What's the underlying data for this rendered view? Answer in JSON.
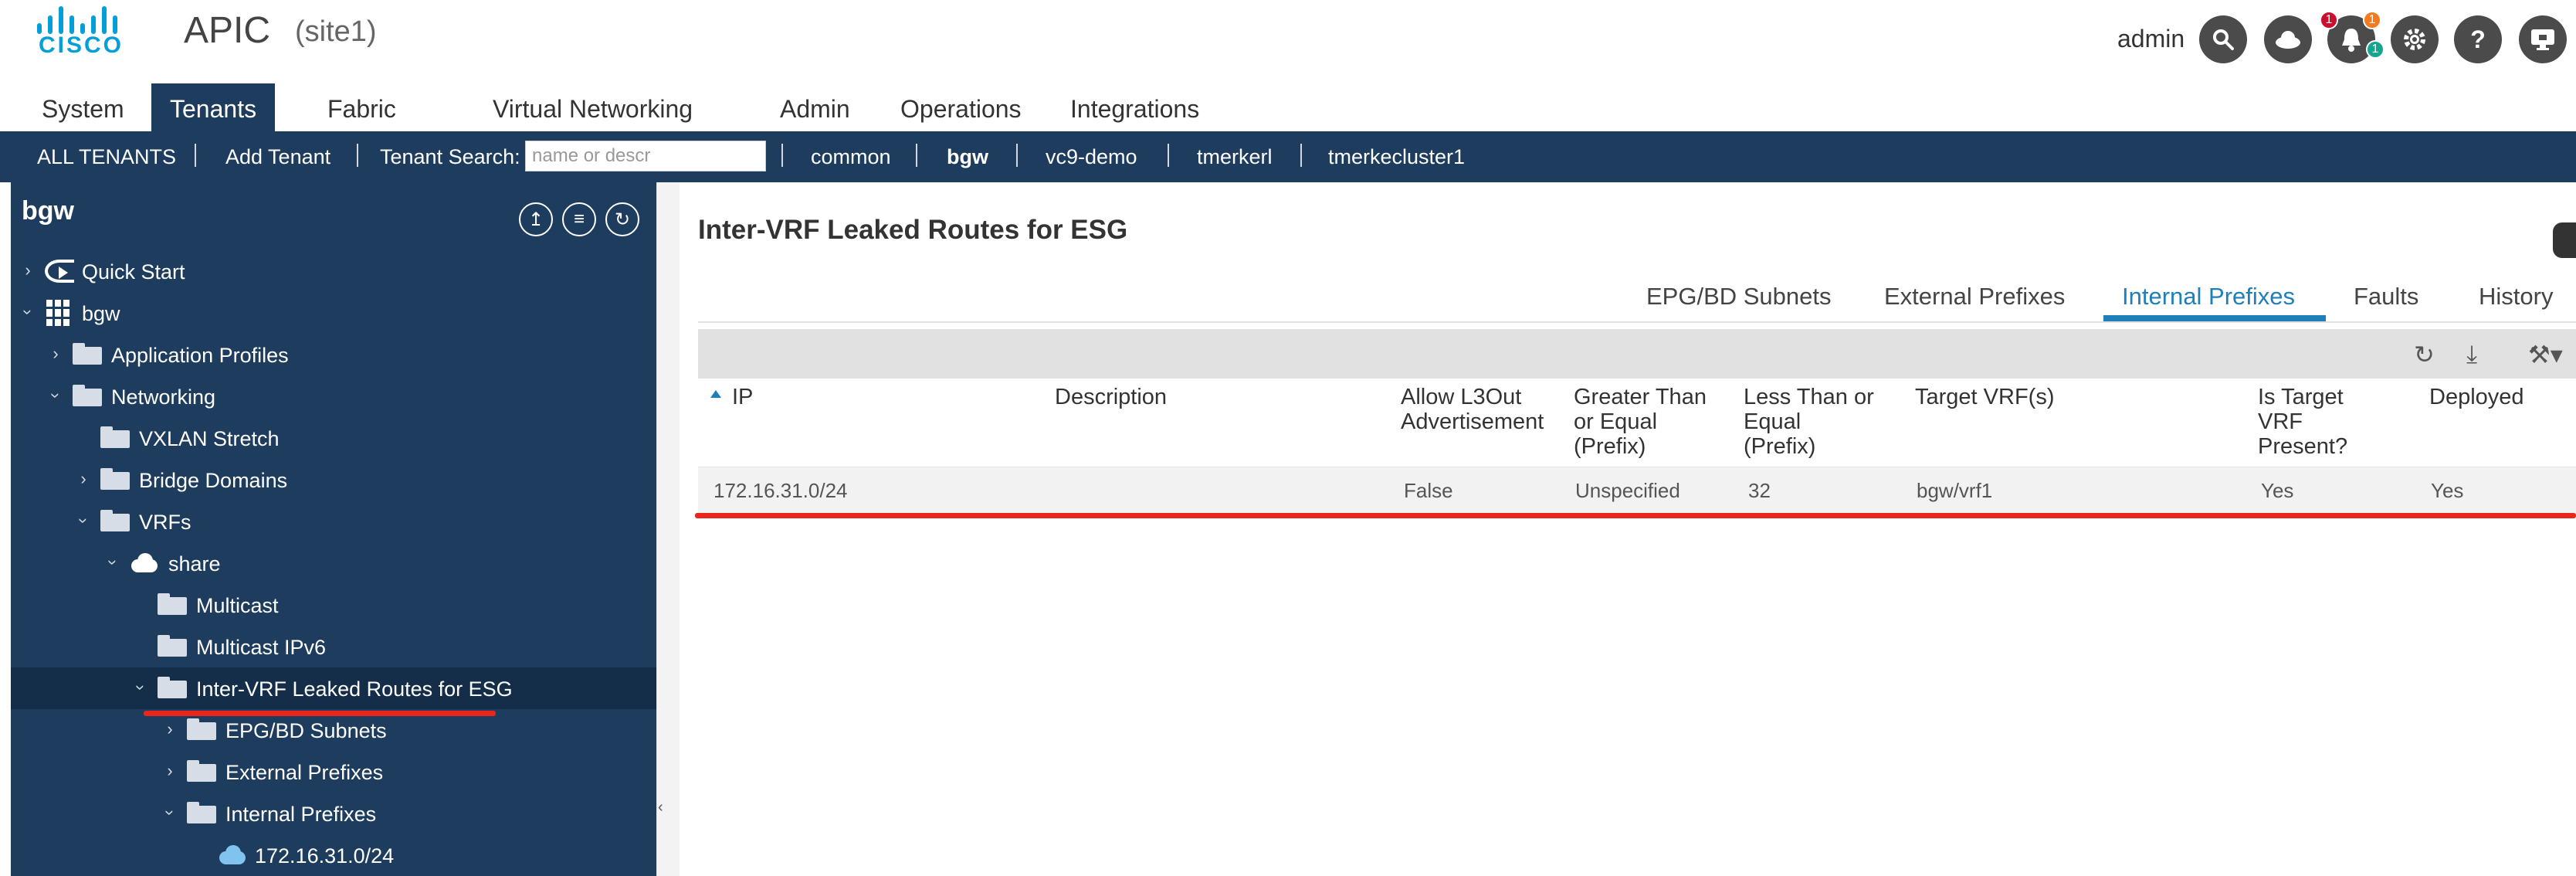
{
  "header": {
    "brand_word": "CISCO",
    "app_title": "APIC",
    "site": "(site1)",
    "user": "admin",
    "icons": [
      "search-icon",
      "cloud-icon",
      "bell-icon",
      "gear-icon",
      "help-icon",
      "monitor-icon"
    ],
    "badges": {
      "critical": "1",
      "major": "1",
      "minor": "1"
    },
    "colors": {
      "brand": "#049fd9",
      "nav": "#1d3c5e",
      "accent": "#1f7fb8",
      "highlight": "#e8261c"
    }
  },
  "main_nav": [
    "System",
    "Tenants",
    "Fabric",
    "Virtual Networking",
    "Admin",
    "Operations",
    "Integrations"
  ],
  "tenant_bar": {
    "all": "ALL TENANTS",
    "add": "Add Tenant",
    "search_label": "Tenant Search:",
    "search_placeholder": "name or descr",
    "tenants": [
      "common",
      "bgw",
      "vc9-demo",
      "tmerkerl",
      "tmerkecluster1"
    ]
  },
  "tree": {
    "title": "bgw",
    "items": [
      {
        "label": "Quick Start"
      },
      {
        "label": "bgw"
      },
      {
        "label": "Application Profiles"
      },
      {
        "label": "Networking"
      },
      {
        "label": "VXLAN Stretch"
      },
      {
        "label": "Bridge Domains"
      },
      {
        "label": "VRFs"
      },
      {
        "label": "share"
      },
      {
        "label": "Multicast"
      },
      {
        "label": "Multicast IPv6"
      },
      {
        "label": "Inter-VRF Leaked Routes for ESG"
      },
      {
        "label": "EPG/BD Subnets"
      },
      {
        "label": "External Prefixes"
      },
      {
        "label": "Internal Prefixes"
      },
      {
        "label": "172.16.31.0/24"
      }
    ]
  },
  "content": {
    "title": "Inter-VRF Leaked Routes for ESG",
    "tabs": [
      "EPG/BD Subnets",
      "External Prefixes",
      "Internal Prefixes",
      "Faults",
      "History"
    ],
    "active_tab": "Internal Prefixes",
    "columns": [
      "IP",
      "Description",
      "Allow L3Out\nAdvertisement",
      "Greater Than\nor Equal\n(Prefix)",
      "Less Than or\nEqual\n(Prefix)",
      "Target VRF(s)",
      "Is Target\nVRF\nPresent?",
      "Deployed"
    ],
    "rows": [
      {
        "ip": "172.16.31.0/24",
        "description": "",
        "allow_l3out": "False",
        "ge": "Unspecified",
        "le": "32",
        "target_vrf": "bgw/vrf1",
        "target_present": "Yes",
        "deployed": "Yes"
      }
    ]
  }
}
